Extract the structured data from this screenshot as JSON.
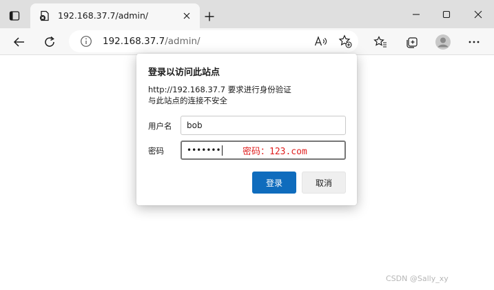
{
  "browser": {
    "tab_title": "192.168.37.7/admin/",
    "url_host": "192.168.37.7",
    "url_path": "/admin/"
  },
  "dialog": {
    "title": "登录以访问此站点",
    "message_line1": "http://192.168.37.7 要求进行身份验证",
    "message_line2": "与此站点的连接不安全",
    "username_label": "用户名",
    "username_value": "bob",
    "password_label": "密码",
    "password_value": "•••••••",
    "password_annotation": "密码：123.com",
    "login_button": "登录",
    "cancel_button": "取消"
  },
  "watermark": "CSDN @Sally_xy",
  "colors": {
    "primary_button": "#0f6cbd",
    "annotation": "#e02020"
  }
}
